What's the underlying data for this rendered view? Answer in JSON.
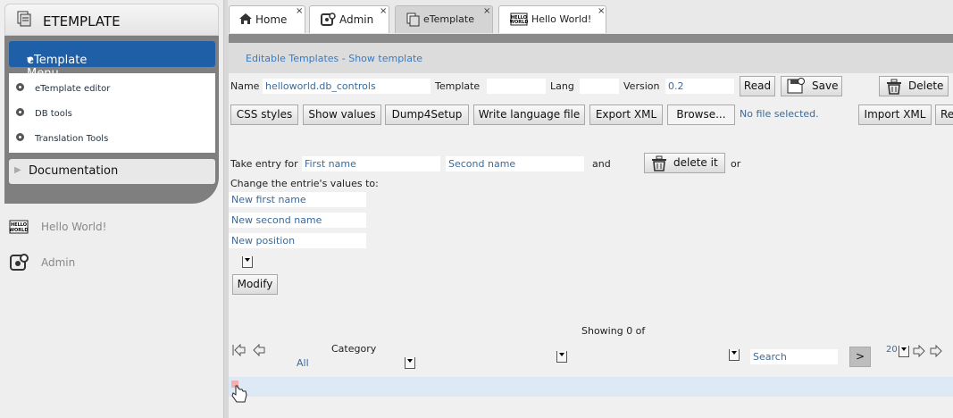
{
  "sidebar": {
    "title": "ETEMPLATE",
    "menu_header": "eTemplate Menu",
    "menu_items": [
      {
        "label": "eTemplate editor"
      },
      {
        "label": "DB tools"
      },
      {
        "label": "Translation Tools"
      }
    ],
    "documentation": "Documentation",
    "apps": [
      {
        "label": "Hello World!",
        "icon": "hello-world-icon"
      },
      {
        "label": "Admin",
        "icon": "admin-icon"
      }
    ]
  },
  "tabs": [
    {
      "label": "Home",
      "icon": "home-icon",
      "active": false
    },
    {
      "label": "Admin",
      "icon": "admin-icon",
      "active": false
    },
    {
      "label": "eTemplate",
      "icon": "etemplate-icon",
      "active": true
    },
    {
      "label": "Hello World!",
      "icon": "hello-world-icon",
      "active": false
    }
  ],
  "tab_close": "×",
  "breadcrumb": "Editable Templates - Show template",
  "template_bar": {
    "name_label": "Name",
    "name_value": "helloworld.db_controls",
    "template_label": "Template",
    "template_value": "",
    "lang_label": "Lang",
    "lang_value": "",
    "version_label": "Version",
    "version_value": "0.2",
    "read": "Read",
    "save": "Save",
    "delete": "Delete"
  },
  "toolbar": {
    "css": "CSS styles",
    "show_values": "Show values",
    "dump": "Dump4Setup",
    "write_lang": "Write language file",
    "export": "Export XML",
    "browse": "Browse...",
    "no_file": "No file selected.",
    "import": "Import XML",
    "re": "Re"
  },
  "form": {
    "take_entry": "Take entry for",
    "first_ph": "First name",
    "second_ph": "Second name",
    "and": "and",
    "delete_it": "delete it",
    "or": "or",
    "change": "Change the entrie's values to:",
    "new_first": "New first name",
    "new_second": "New second name",
    "new_position": "New position",
    "modify": "Modify"
  },
  "nm": {
    "showing": "Showing 0 of",
    "category": "Category",
    "category_value": "All",
    "search_ph": "Search",
    "go": ">",
    "page_size": "20"
  }
}
